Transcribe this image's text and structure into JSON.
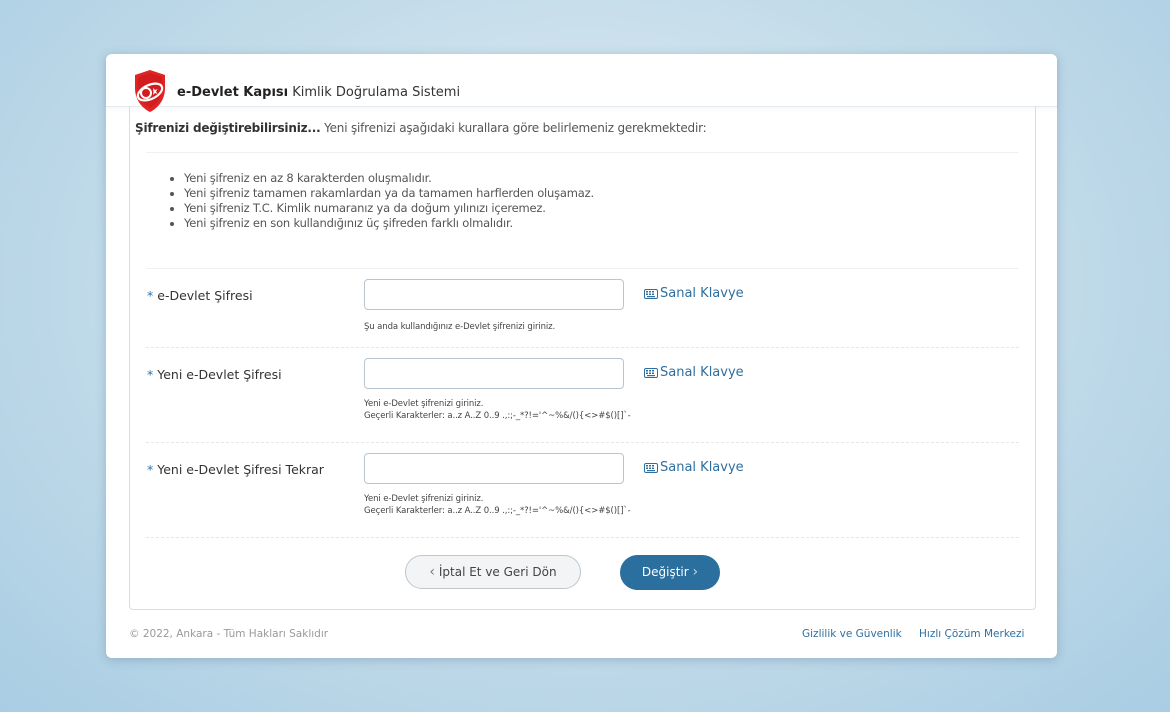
{
  "header": {
    "brand_bold": "e-Devlet Kapısı",
    "brand_rest": " Kimlik Doğrulama Sistemi"
  },
  "intro": {
    "bold": "Şifrenizi değiştirebilirsiniz...",
    "text": " Yeni şifrenizi aşağıdaki kurallara göre belirlemeniz gerekmektedir:"
  },
  "rules": [
    "Yeni şifreniz en az 8 karakterden oluşmalıdır.",
    "Yeni şifreniz tamamen rakamlardan ya da tamamen harflerden oluşamaz.",
    "Yeni şifreniz T.C. Kimlik numaranız ya da doğum yılınızı içeremez.",
    "Yeni şifreniz en son kullandığınız üç şifreden farklı olmalıdır."
  ],
  "form": {
    "required_mark": "*",
    "virtual_keyboard_label": "Sanal Klavye",
    "fields": [
      {
        "label": "e-Devlet Şifresi",
        "value": "",
        "help": "Şu anda kullandığınız e-Devlet şifrenizi giriniz."
      },
      {
        "label": "Yeni e-Devlet Şifresi",
        "value": "",
        "help": "Yeni e-Devlet şifrenizi giriniz.",
        "chars": "Geçerli Karakterler: a..z A..Z 0..9 .,:;-_*?!='^~%&/(){<>#$()[]`-"
      },
      {
        "label": "Yeni e-Devlet Şifresi Tekrar",
        "value": "",
        "help": "Yeni e-Devlet şifrenizi giriniz.",
        "chars": "Geçerli Karakterler: a..z A..Z 0..9 .,:;-_*?!='^~%&/(){<>#$()[]`-"
      }
    ]
  },
  "buttons": {
    "cancel": "İptal Et ve Geri Dön",
    "submit": "Değiştir"
  },
  "footer": {
    "copyright": "© 2022, Ankara - Tüm Hakları Saklıdır",
    "links": [
      "Gizlilik ve Güvenlik",
      "Hızlı Çözüm Merkezi"
    ]
  },
  "colors": {
    "accent": "#2a6f9d",
    "link": "#2f6f9f",
    "logo_red": "#e02424"
  }
}
